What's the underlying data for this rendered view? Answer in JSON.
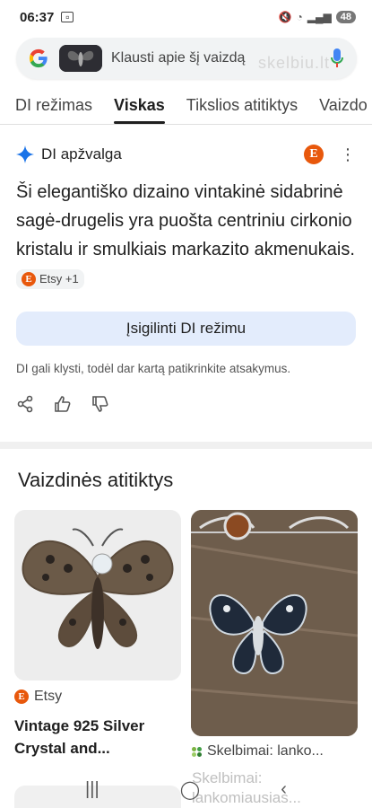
{
  "status": {
    "time": "06:37",
    "battery": "48"
  },
  "search": {
    "placeholder": "Klausti apie šį vaizdą",
    "watermark": "skelbiu.lt"
  },
  "tabs": [
    {
      "label": "DI režimas",
      "active": false
    },
    {
      "label": "Viskas",
      "active": true
    },
    {
      "label": "Tikslios atitiktys",
      "active": false
    },
    {
      "label": "Vaizdo",
      "active": false
    }
  ],
  "ai": {
    "title": "DI apžvalga",
    "text": "Ši elegantiško dizaino vintakinė sidabrinė sagė-drugelis yra puošta centriniu cirkonio kristalu ir smulkiais markazito akmenukais.",
    "chip": "Etsy +1",
    "badge_letter": "E",
    "deep_button": "Įsigilinti DI režimu",
    "disclaimer": "DI gali klysti, todėl dar kartą patikrinkite atsakymus."
  },
  "visual": {
    "title": "Vaizdinės atitiktys",
    "results": [
      {
        "source": "Etsy",
        "caption": "Vintage 925 Silver Crystal and..."
      },
      {
        "source": "Skelbimai: lanko...",
        "caption": "Skelbimai: lankomiausias..."
      }
    ]
  },
  "colors": {
    "accent": "#1a73e8",
    "etsy": "#e8580c",
    "deep_button_bg": "#e3ecfc"
  }
}
